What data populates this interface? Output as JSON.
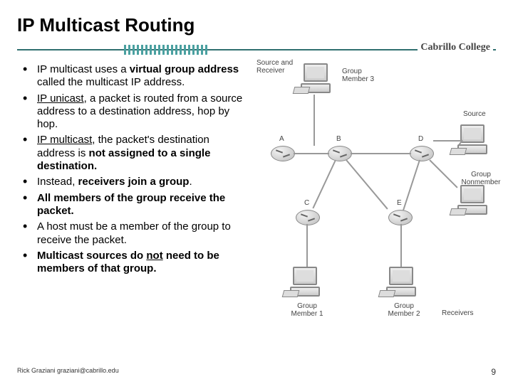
{
  "title": "IP Multicast Routing",
  "brand": "Cabrillo College",
  "bullets": [
    "IP multicast uses a <b>virtual group address</b> called the multicast IP address.",
    "<span class='u'>IP unicast</span>, a packet is routed from a source address to a destination address, hop by hop.",
    "<span class='u'>IP multicast</span>, the packet's destination address is <b>not assigned to a single destination.</b>",
    "Instead, <b>receivers join a group</b>.",
    "<b>All members of the group receive the packet.</b>",
    "A host must be a member of the group to receive the packet.",
    "<b>Multicast sources do <span class='u'>not</span> need to be members of that group.</b>"
  ],
  "diagram": {
    "top_group_label": "Source and\nReceiver",
    "hosts": {
      "top": {
        "label": "Group\nMember 3"
      },
      "right_top": {
        "label": "Source"
      },
      "right_bottom": {
        "label": "Group\nNonmember"
      },
      "bottom_left": {
        "label": "Group\nMember 1"
      },
      "bottom_right": {
        "label": "Group\nMember 2"
      }
    },
    "routers": [
      "A",
      "B",
      "C",
      "D",
      "E"
    ],
    "receivers_label": "Receivers"
  },
  "footer": {
    "left": "Rick Graziani  graziani@cabrillo.edu",
    "page": "9"
  }
}
